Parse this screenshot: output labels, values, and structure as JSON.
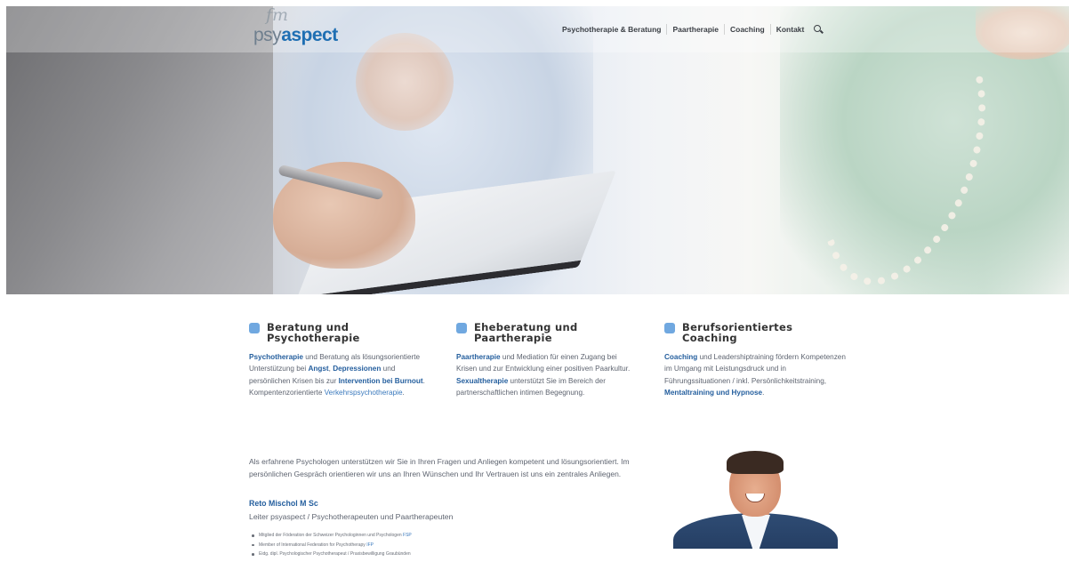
{
  "header": {
    "logo_script": "fm",
    "logo_part1": "psy",
    "logo_part2": "aspect",
    "nav": [
      {
        "label": "Psychotherapie & Beratung"
      },
      {
        "label": "Paartherapie"
      },
      {
        "label": "Coaching"
      },
      {
        "label": "Kontakt"
      }
    ],
    "search_icon": "search-icon"
  },
  "columns": [
    {
      "title_line1": "Beratung und",
      "title_line2": "Psychotherapie",
      "text": [
        {
          "t": "Psychotherapie",
          "style": "link"
        },
        {
          "t": " und Beratung als lösungsorientierte Unterstützung bei ",
          "style": "plain"
        },
        {
          "t": "Angst",
          "style": "link"
        },
        {
          "t": ", ",
          "style": "plain"
        },
        {
          "t": "Depressionen",
          "style": "link"
        },
        {
          "t": " und persönlichen Krisen bis zur ",
          "style": "plain"
        },
        {
          "t": "Intervention bei Burnout",
          "style": "link"
        },
        {
          "t": ". Kompentenzorientierte ",
          "style": "plain"
        },
        {
          "t": "Verkehrspsychotherapie",
          "style": "link-normal"
        },
        {
          "t": ".",
          "style": "plain"
        }
      ]
    },
    {
      "title_line1": "Eheberatung und",
      "title_line2": "Paartherapie",
      "text": [
        {
          "t": "Paartherapie",
          "style": "link"
        },
        {
          "t": " und Mediation für einen Zugang bei Krisen und zur Entwicklung einer positiven Paarkultur. ",
          "style": "plain"
        },
        {
          "t": "Sexualtherapie",
          "style": "link"
        },
        {
          "t": " unterstützt Sie im Bereich der partnerschaftlichen intimen Begegnung.",
          "style": "plain"
        }
      ]
    },
    {
      "title_line1": "Berufsorientiertes Coaching",
      "title_line2": "",
      "text": [
        {
          "t": "Coaching",
          "style": "link"
        },
        {
          "t": " und Leadershiptraining fördern Kompetenzen im Umgang mit Leistungsdruck und in Führungssituationen / inkl. Persönlichkeitstraining, ",
          "style": "plain"
        },
        {
          "t": "Mentaltraining und Hypnose",
          "style": "link"
        },
        {
          "t": ".",
          "style": "plain"
        }
      ]
    }
  ],
  "about": {
    "intro": "Als erfahrene Psychologen unterstützen wir Sie in Ihren Fragen und Anliegen kompetent und lösungsorientiert. Im persönlichen Gespräch orientieren wir uns an Ihren Wünschen und Ihr Vertrauen ist uns ein zentrales Anliegen.",
    "name": "Reto Mischol M Sc",
    "role": "Leiter psyaspect / Psychotherapeuten und Paartherapeuten",
    "bullets": [
      {
        "text": "Mitglied der Föderation der Schweizer Psychologinnen und Psychologen ",
        "link": "FSP"
      },
      {
        "text": "Member of International Federation for Psychotherapy ",
        "link": "IFP"
      },
      {
        "text": "Eidg. dipl. Psychologischer Psychotherapeut / Praxisbewilligung Graubünden",
        "link": ""
      }
    ]
  },
  "colors": {
    "accent": "#70a8e0",
    "link": "#255f9e",
    "logo_blue": "#1f6fb3",
    "logo_grey": "#6f7f8e"
  }
}
